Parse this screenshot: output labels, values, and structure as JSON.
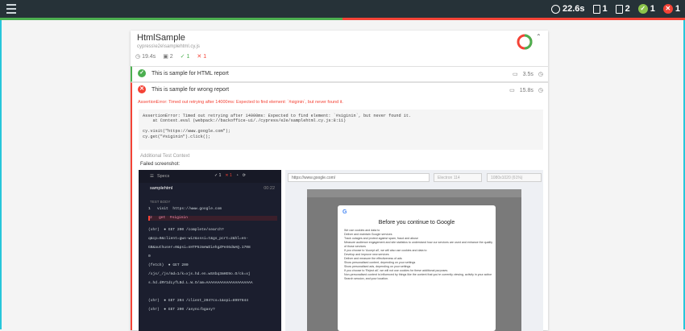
{
  "topbar": {
    "duration": "22.6s",
    "suites": "1",
    "tests": "2",
    "passed": "1",
    "failed": "1",
    "pass_ratio": 0.5
  },
  "suite": {
    "title": "HtmlSample",
    "file": "cypress\\e2e\\samplehtml.cy.js",
    "duration": "19.4s",
    "tests": "2",
    "passed": "1",
    "failed": "1"
  },
  "tests": [
    {
      "name": "This is sample for HTML report",
      "duration": "3.5s",
      "state": "passed"
    },
    {
      "name": "This is sample for wrong report",
      "duration": "15.8s",
      "state": "failed"
    }
  ],
  "error": {
    "message": "AssertionError: Timed out retrying after 14000ms: Expected to find element: `#siginin`, but never found it.",
    "code_lines": [
      "AssertionError: Timed out retrying after 14000ms: Expected to find element: `#siginin`, but never found it.",
      "    at Context.eval (webpack://backoffice-ui/./cypress/e2e/samplehtml.cy.js:8:11)",
      "",
      "cy.visit(\"https://www.google.com\");",
      "cy.get(\"#siginin\").click();"
    ]
  },
  "context": {
    "label": "Additional Test Context",
    "failed_label": "Failed screenshot:"
  },
  "screenshot": {
    "specs_label": "Specs",
    "passed": "1",
    "failed": "1",
    "file": "samplehtml",
    "file_time": "00:22",
    "test_body": "TEST BODY",
    "cmd1": "1   visit  https://www.google.com",
    "cmd2": "2   get  #siginin",
    "xhr_lines": [
      "(xhr)  ● GET 200 /complete/search?",
      "q&cp=0&client=gws-wiz&xssi=t&gs_pcrt=2&hl=en-",
      "GB&authuser=0&psi=nHTP5zmeWZiehgZPeX6dmAQ.1708",
      "0",
      "(fetch)  ● GET 200",
      "/xjs/_/js/md=1/k=xjs.hd.en.w5Xbq3mHE9o.O/ck=xj",
      "s.hd.dRY1dLyfLBd.L.W.O/am=AAAAAAAAAAAAAAAAAAAAA",
      "",
      "(xhr)  ● GET 204 /client_204?cs=1&opi=8997844",
      "(xhr)  ● GET 200 /async/bgasy?"
    ],
    "url": "https://www.google.com/",
    "browser": "Electron 114",
    "viewport": "1080x1020  (61%)",
    "dialog_title": "Before you continue to Google",
    "dialog_lines": [
      "We use cookies and data to",
      "Deliver and maintain Google services",
      "Track outages and protect against spam, fraud and abuse",
      "Measure audience engagement and site statistics to understand how our services are used and enhance the quality of those services",
      "If you choose to 'Accept all', we will also use cookies and data to",
      "Develop and improve new services",
      "Deliver and measure the effectiveness of ads",
      "Show personalised content, depending on your settings",
      "Show personalised ads, depending on your settings",
      "If you choose to 'Reject all', we will not use cookies for these additional purposes.",
      "Non-personalised content is influenced by things like the content that you're currently viewing, activity in your active Search session, and your location."
    ]
  }
}
